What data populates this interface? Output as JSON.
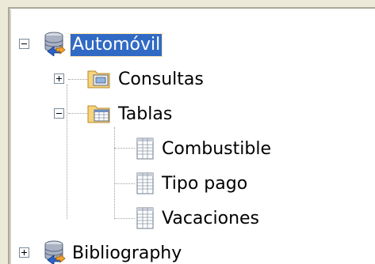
{
  "tree": {
    "nodes": [
      {
        "label": "Automóvil",
        "icon": "database-icon",
        "expanded": true,
        "selected": true
      },
      {
        "label": "Consultas",
        "icon": "queries-folder-icon",
        "expanded": false
      },
      {
        "label": "Tablas",
        "icon": "tables-folder-icon",
        "expanded": true
      },
      {
        "label": "Combustible",
        "icon": "table-icon"
      },
      {
        "label": "Tipo pago",
        "icon": "table-icon"
      },
      {
        "label": "Vacaciones",
        "icon": "table-icon"
      },
      {
        "label": "Bibliography",
        "icon": "database-icon",
        "expanded": false
      }
    ]
  },
  "colors": {
    "selection": "#316ac5",
    "background": "#ffffff",
    "frame": "#ece9d8"
  }
}
